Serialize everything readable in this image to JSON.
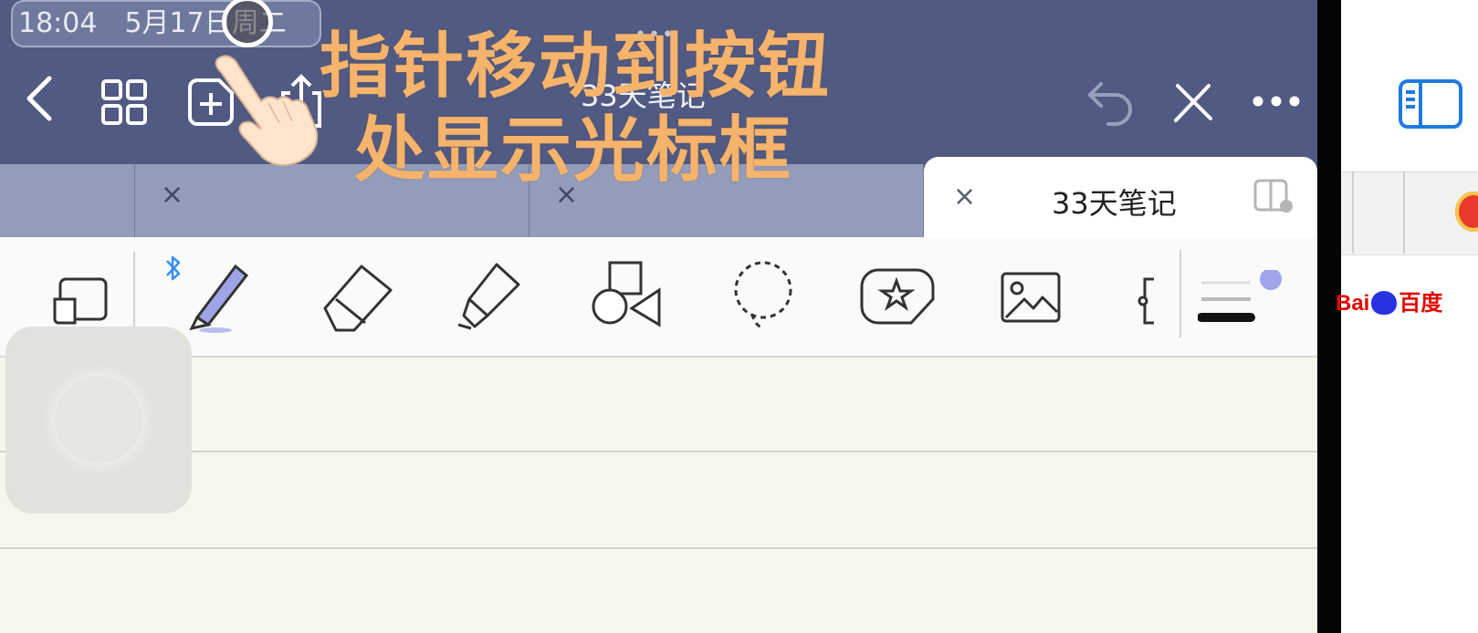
{
  "status_bar": {
    "time": "18:04",
    "date": "5月17日周二"
  },
  "header": {
    "title": "33天笔记",
    "more_dots": "•••"
  },
  "tabs": [
    {
      "label": "",
      "close": "×"
    },
    {
      "label": "",
      "close": "×"
    },
    {
      "label": "33天笔记",
      "close": "×",
      "active": true
    }
  ],
  "caption": {
    "line1": "指针移动到按钮",
    "line2": "处显示光标框"
  },
  "tools": [
    "page-layout",
    "pen",
    "eraser",
    "highlighter",
    "shapes",
    "lasso",
    "sticker",
    "image",
    "text",
    "stroke-style"
  ],
  "colors": {
    "accent": "#505a82",
    "caption": "#f5b36b",
    "pen": "#8a8fd6",
    "paper": "#f7f6ec"
  },
  "right_panel": {
    "baidu_text": "Bai",
    "baidu_text2": "百度",
    "du": "du"
  }
}
